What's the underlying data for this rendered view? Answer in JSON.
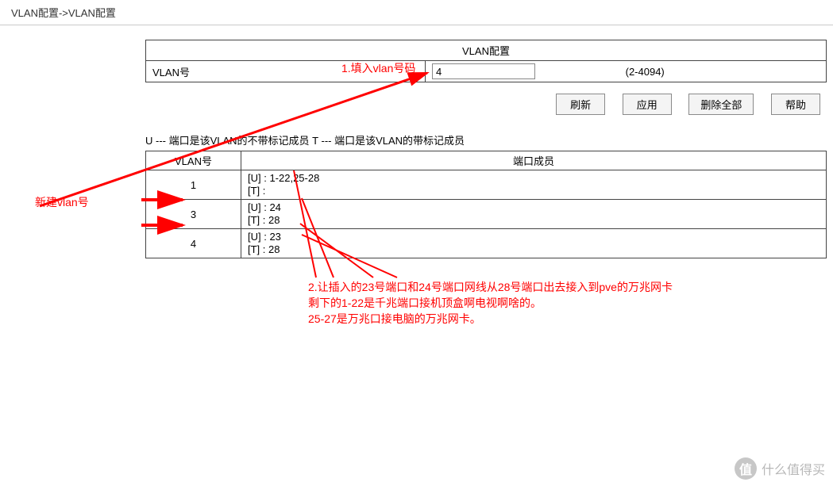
{
  "breadcrumb": "VLAN配置->VLAN配置",
  "config_table": {
    "title": "VLAN配置",
    "row_label": "VLAN号",
    "input_value": "4",
    "range_hint": "(2-4094)"
  },
  "buttons": {
    "refresh": "刷新",
    "apply": "应用",
    "delete_all": "删除全部",
    "help": "帮助"
  },
  "legend_text": "U --- 端口是该VLAN的不带标记成员    T --- 端口是该VLAN的带标记成员",
  "members_header": {
    "vlan": "VLAN号",
    "ports": "端口成员"
  },
  "members": [
    {
      "vlan": "1",
      "u": "[U] : 1-22,25-28",
      "t": "[T] :"
    },
    {
      "vlan": "3",
      "u": "[U] : 24",
      "t": "[T] : 28"
    },
    {
      "vlan": "4",
      "u": "[U] : 23",
      "t": "[T] : 28"
    }
  ],
  "annotations": {
    "a1": "1.填入vlan号码",
    "new_vlan": "新建vlan号",
    "a2_l1": "2.让插入的23号端口和24号端口网线从28号端口出去接入到pve的万兆网卡",
    "a2_l2": "剩下的1-22是千兆端口接机顶盒啊电视啊啥的。",
    "a2_l3": "25-27是万兆口接电脑的万兆网卡。"
  },
  "watermark": {
    "badge": "值",
    "text": "什么值得买"
  }
}
